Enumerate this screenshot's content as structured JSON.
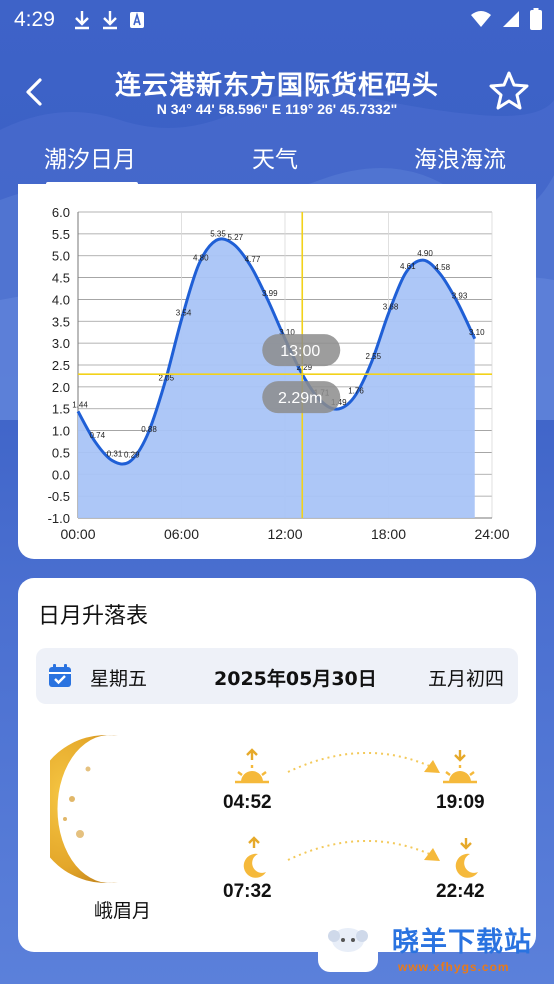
{
  "status_bar": {
    "time": "4:29"
  },
  "header": {
    "title": "连云港新东方国际货柜码头",
    "coords": "N 34° 44' 58.596\"   E 119° 26' 45.7332\""
  },
  "tabs": [
    {
      "label": "潮汐日月",
      "active": true
    },
    {
      "label": "天气",
      "active": false
    },
    {
      "label": "海浪海流",
      "active": false
    }
  ],
  "chart_data": {
    "type": "area",
    "y_ticks": [
      "6.0",
      "5.5",
      "5.0",
      "4.5",
      "4.0",
      "3.5",
      "3.0",
      "2.5",
      "2.0",
      "1.5",
      "1.0",
      "0.5",
      "0.0",
      "-0.5",
      "-1.0"
    ],
    "x_ticks": [
      "00:00",
      "06:00",
      "12:00",
      "18:00",
      "24:00"
    ],
    "ylim": [
      -1.0,
      6.0
    ],
    "xlim": [
      0,
      24
    ],
    "grid": true,
    "fill_color": "#a9c4f7",
    "line_color": "#1f5fd6",
    "series": [
      {
        "x": [
          0,
          1,
          2,
          3,
          4,
          5,
          6,
          7,
          8,
          9,
          10,
          11,
          12,
          13,
          14,
          15,
          16,
          17,
          18,
          19,
          20,
          21,
          22,
          23
        ],
        "values": [
          1.44,
          0.74,
          0.31,
          0.29,
          0.88,
          2.05,
          3.54,
          4.8,
          5.35,
          5.27,
          4.77,
          3.99,
          3.1,
          2.29,
          1.71,
          1.49,
          1.76,
          2.55,
          3.68,
          4.61,
          4.9,
          4.58,
          3.93,
          3.1
        ]
      }
    ],
    "point_labels": [
      "1.44",
      "0.74",
      "0.31",
      "0.29",
      "0.88",
      "2.05",
      "3.54",
      "4.80",
      "5.35",
      "5.27",
      "4.77",
      "3.99",
      "3.10",
      "2.29",
      "1.71",
      "1.49",
      "1.76",
      "2.55",
      "3.68",
      "4.61",
      "4.90",
      "4.58",
      "3.93",
      "3.10"
    ],
    "crosshair": {
      "x": 13,
      "y": 2.29,
      "color": "#f2d21a",
      "time_label": "13:00",
      "value_label": "2.29m"
    }
  },
  "sun_moon": {
    "title": "日月升落表",
    "weekday": "星期五",
    "date": "2025年05月30日",
    "lunar_date": "五月初四",
    "moon_phase": "峨眉月",
    "sunrise": "04:52",
    "sunset": "19:09",
    "moonrise": "07:32",
    "moonset": "22:42"
  },
  "watermark": {
    "text": "晓羊下载站",
    "url": "www.xfhygs.com"
  }
}
